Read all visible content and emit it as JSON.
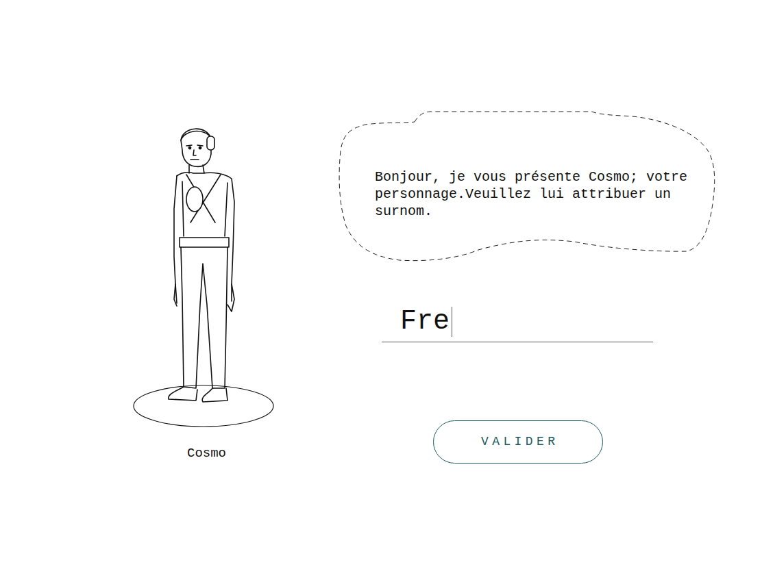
{
  "character": {
    "name": "Cosmo"
  },
  "speech_bubble": {
    "text": "Bonjour, je vous présente Cosmo; votre personnage.Veuillez lui attribuer un surnom."
  },
  "nickname_field": {
    "value": "Fre",
    "focused": true
  },
  "buttons": [
    "VALIDER"
  ]
}
